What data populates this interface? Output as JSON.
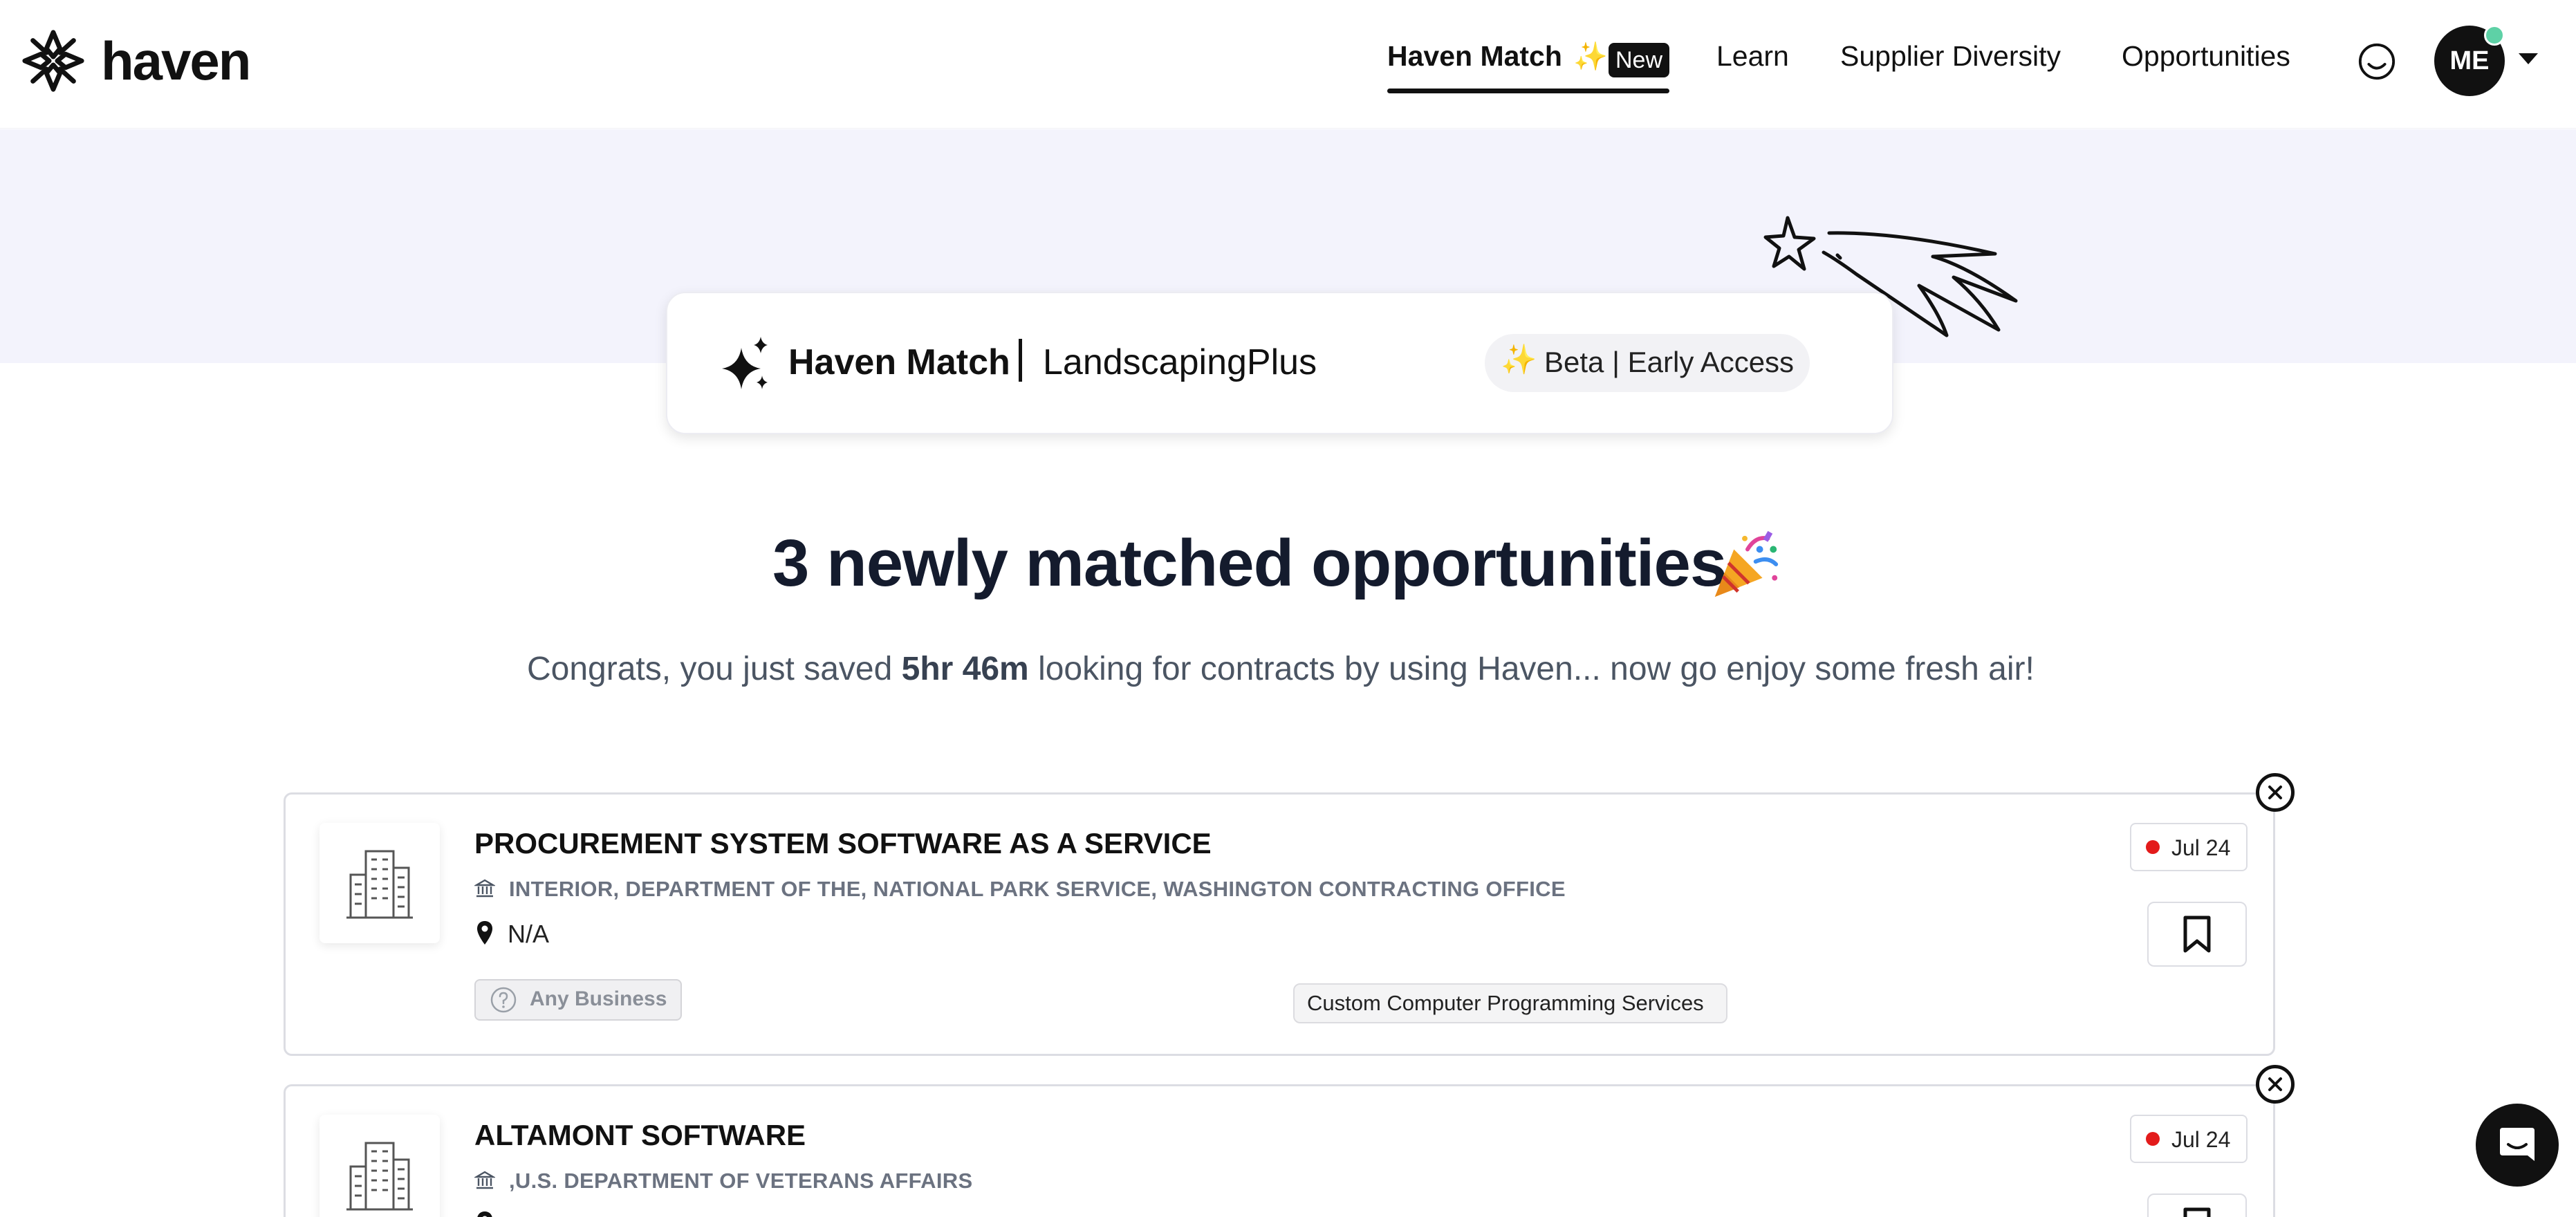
{
  "header": {
    "logo_text": "haven",
    "nav": [
      {
        "label": "Haven Match",
        "active": true,
        "sparkle": "✨",
        "badge": "New"
      },
      {
        "label": "Learn",
        "active": false
      },
      {
        "label": "Supplier Diversity",
        "active": false
      },
      {
        "label": "Opportunities",
        "active": false
      }
    ],
    "feedback_icon": "smile-icon",
    "avatar_initials": "ME",
    "avatar_status_color": "#5ed1a6"
  },
  "match_card": {
    "title": "Haven Match",
    "company": "LandscapingPlus",
    "beta_sparkle": "✨",
    "beta_label": "Beta | Early Access"
  },
  "summary": {
    "headline": "3 newly matched opportunities",
    "celebration_icon": "party-popper-icon",
    "congrats_prefix": "Congrats, you just saved ",
    "time_saved": "5hr 46m",
    "congrats_suffix": " looking for contracts by using Haven... now go enjoy some fresh air!"
  },
  "opportunities": [
    {
      "title": "PROCUREMENT SYSTEM SOFTWARE AS A SERVICE",
      "agency": "INTERIOR, DEPARTMENT OF THE, NATIONAL PARK SERVICE, WASHINGTON CONTRACTING OFFICE",
      "location": "N/A",
      "set_aside": "Any Business",
      "naics": "Custom Computer Programming Services",
      "due_date": "Jul 24",
      "due_status_color": "#e31b1b"
    },
    {
      "title": "ALTAMONT SOFTWARE",
      "agency": ",U.S. DEPARTMENT OF VETERANS AFFAIRS",
      "due_date": "Jul 24",
      "due_status_color": "#e31b1b"
    }
  ],
  "chat_launcher_icon": "chat-bubble-icon"
}
